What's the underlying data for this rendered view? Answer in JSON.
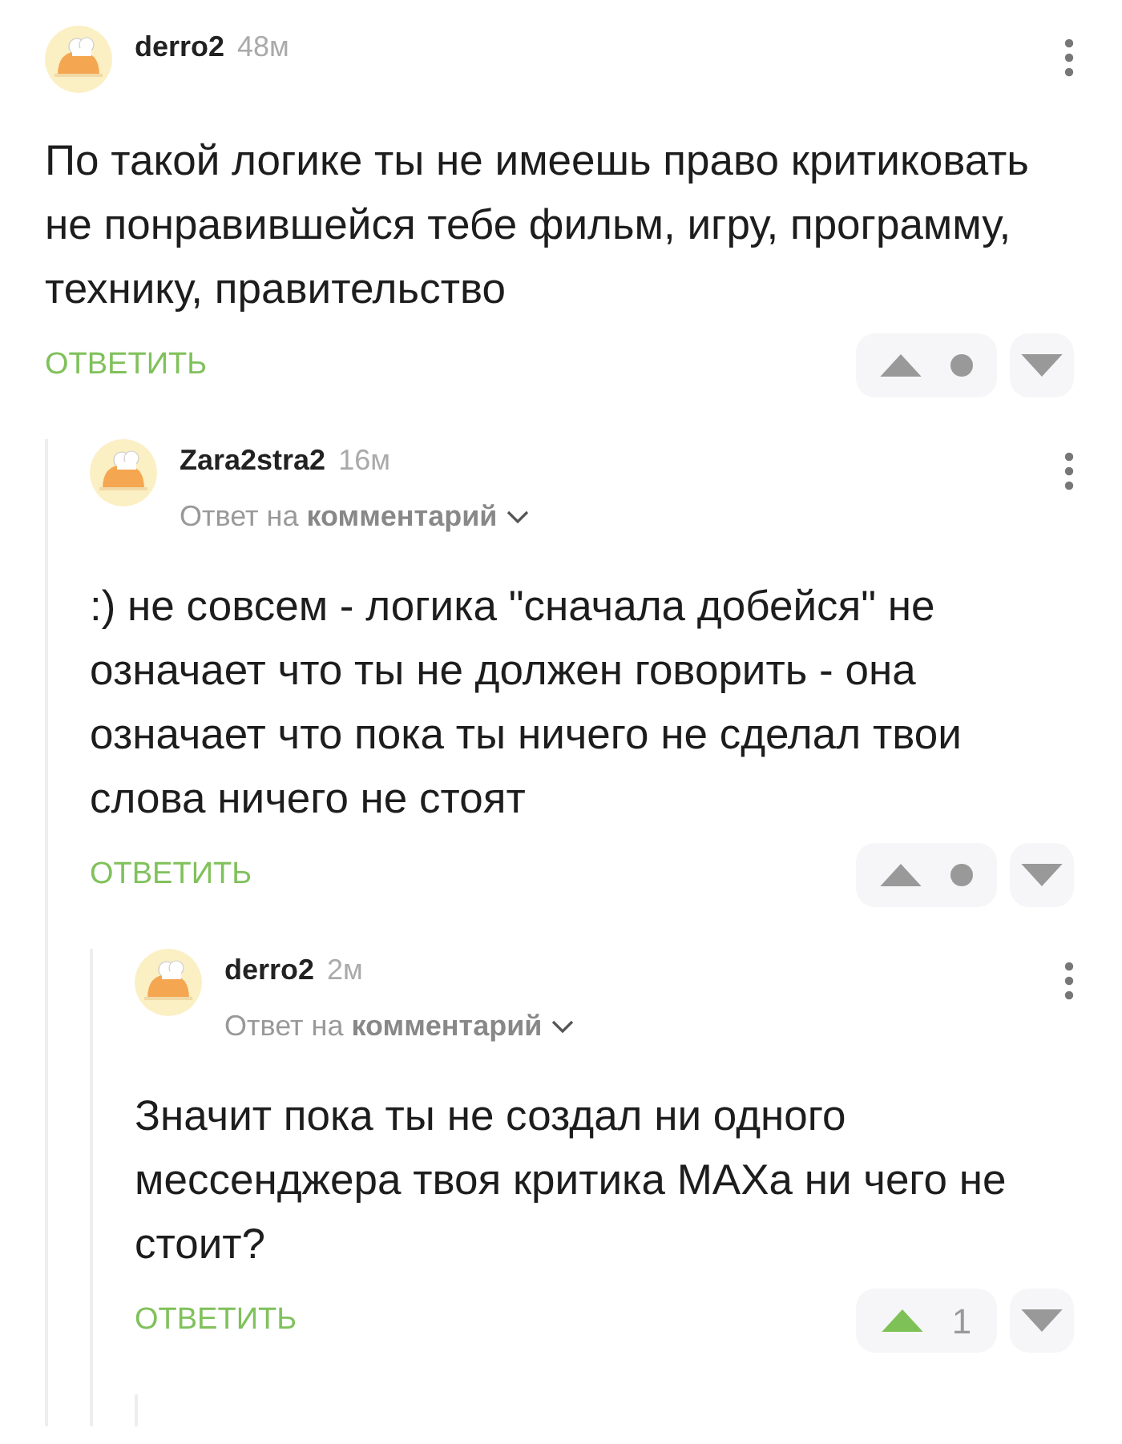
{
  "comments": [
    {
      "author": "derro2",
      "time": "48м",
      "text": "По такой логике ты не имеешь право критиковать не понравившейся тебе фильм, игру, программу, технику, правительство",
      "reply_label": "ОТВЕТИТЬ",
      "vote": {
        "upvoted": false,
        "kind": "dot"
      },
      "children": [
        {
          "author": "Zara2stra2",
          "time": "16м",
          "reply_to": "Ответ на **комментарий**",
          "text": ":) не совсем - логика \"сначала добейся\" не означает что ты не должен говорить - она означает что пока ты ничего не сделал твои слова ничего не стоят",
          "reply_label": "ОТВЕТИТЬ",
          "vote": {
            "upvoted": false,
            "kind": "dot"
          },
          "children": [
            {
              "author": "derro2",
              "time": "2м",
              "reply_to": "Ответ на **комментарий**",
              "text": "Значит пока ты не создал ни одного мессенджера твоя критика МАХа ни чего не стоит?",
              "reply_label": "ОТВЕТИТЬ",
              "vote": {
                "upvoted": true,
                "kind": "score",
                "score": "1"
              },
              "more_replies_below": true
            }
          ]
        }
      ]
    }
  ]
}
